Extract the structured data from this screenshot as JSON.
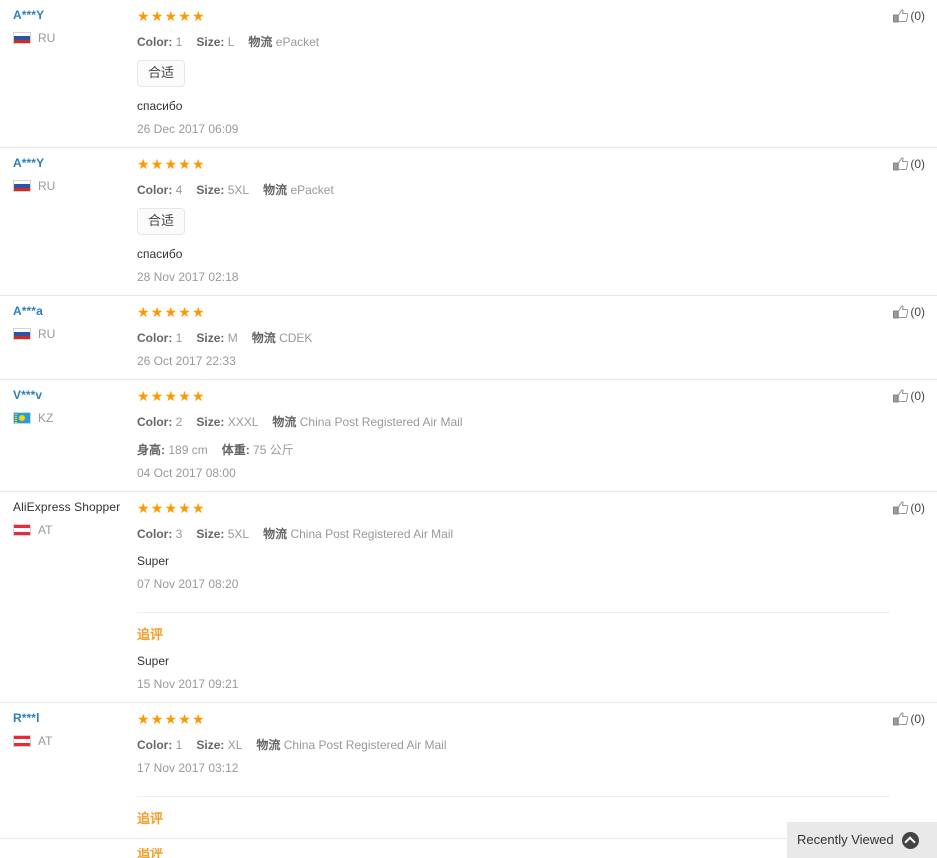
{
  "page": {
    "title": "AliExpress Product Reviews",
    "accent_color": "#f0a02a",
    "star_color": "#ff9800",
    "link_color": "#2a7fc1"
  },
  "labels": {
    "color_key": "Color:",
    "size_key": "Size:",
    "logistics_key": "物流",
    "height_key": "身高:",
    "weight_key": "体重:",
    "additional_review": "追评",
    "fit_tag": "合适",
    "stars_full": "★★★★★"
  },
  "recently_viewed": {
    "label": "Recently Viewed",
    "icon": "chevron-up-circle-icon"
  },
  "reviews": [
    {
      "user": "A***Y",
      "user_is_link": true,
      "country_code": "RU",
      "flag": "ru",
      "rating": 5,
      "stars": "★★★★★",
      "color": "1",
      "size": "L",
      "logistics": "ePacket",
      "fit_tag": "合适",
      "text": "спасибо",
      "date": "26 Dec 2017 06:09",
      "helpful_count": "(0)"
    },
    {
      "user": "A***Y",
      "user_is_link": true,
      "country_code": "RU",
      "flag": "ru",
      "rating": 5,
      "stars": "★★★★★",
      "color": "4",
      "size": "5XL",
      "logistics": "ePacket",
      "fit_tag": "合适",
      "text": "спасибо",
      "date": "28 Nov 2017 02:18",
      "helpful_count": "(0)"
    },
    {
      "user": "A***a",
      "user_is_link": true,
      "country_code": "RU",
      "flag": "ru",
      "rating": 5,
      "stars": "★★★★★",
      "color": "1",
      "size": "M",
      "logistics": "CDEK",
      "date": "26 Oct 2017 22:33",
      "helpful_count": "(0)"
    },
    {
      "user": "V***v",
      "user_is_link": true,
      "country_code": "KZ",
      "flag": "kz",
      "rating": 5,
      "stars": "★★★★★",
      "color": "2",
      "size": "XXXL",
      "logistics": "China Post Registered Air Mail",
      "height": "189 cm",
      "weight": "75 公斤",
      "date": "04 Oct 2017 08:00",
      "helpful_count": "(0)"
    },
    {
      "user": "AliExpress Shopper",
      "user_is_link": false,
      "country_code": "AT",
      "flag": "at",
      "rating": 5,
      "stars": "★★★★★",
      "color": "3",
      "size": "5XL",
      "logistics": "China Post Registered Air Mail",
      "text": "Super",
      "date": "07 Nov 2017 08:20",
      "helpful_count": "(0)",
      "additional": {
        "title": "追评",
        "text": "Super",
        "date": "15 Nov 2017 09:21"
      }
    },
    {
      "user": "R***l",
      "user_is_link": true,
      "country_code": "AT",
      "flag": "at",
      "rating": 5,
      "stars": "★★★★★",
      "color": "1",
      "size": "XL",
      "logistics": "China Post Registered Air Mail",
      "date": "17 Nov 2017 03:12",
      "helpful_count": "(0)",
      "additional": {
        "title": "追评"
      }
    }
  ]
}
